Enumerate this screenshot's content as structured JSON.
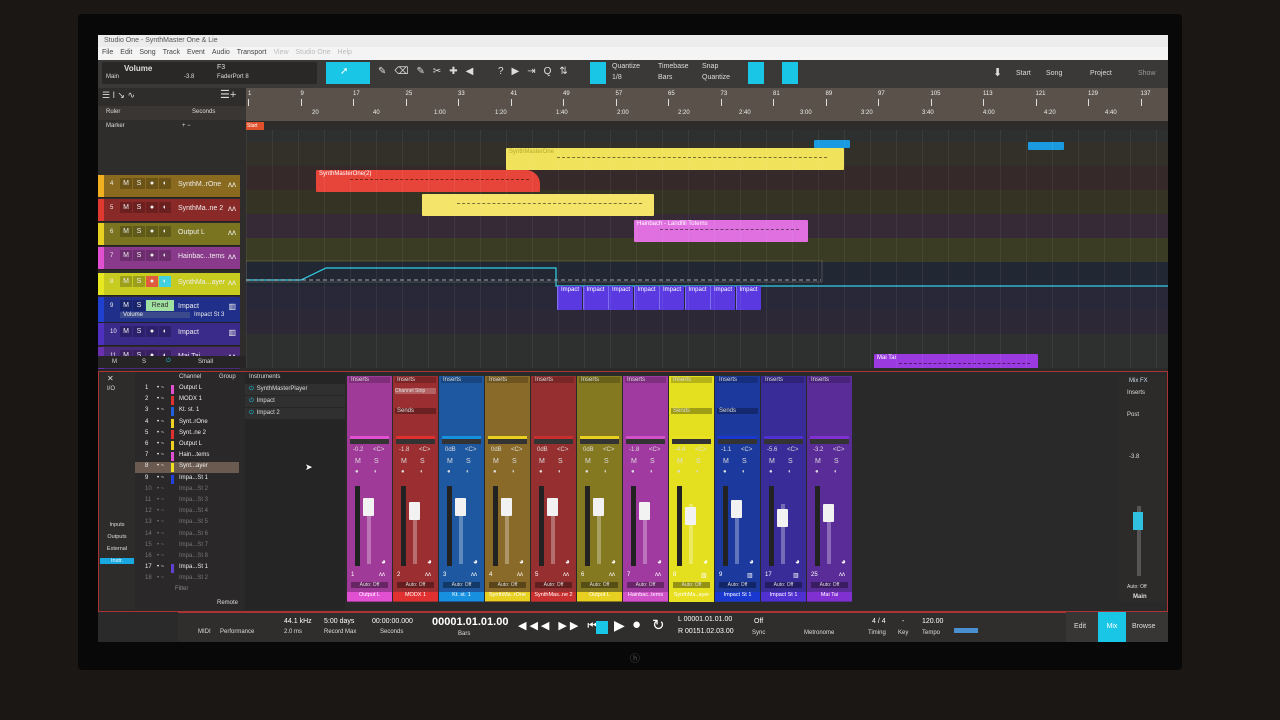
{
  "window": {
    "title": "Studio One - SynthMaster One & Lie"
  },
  "menu": [
    "File",
    "Edit",
    "Song",
    "Track",
    "Event",
    "Audio",
    "Transport",
    "View",
    "Studio One",
    "Help"
  ],
  "toolbar": {
    "param_name": "Volume",
    "param_scope": "Main",
    "param_value": "-3.8",
    "device_key": "F3",
    "device_name": "FaderPort 8",
    "quantize_label": "Quantize",
    "quantize_value": "1/8",
    "timebase_label": "Timebase",
    "timebase_value": "Bars",
    "snap_label": "Snap",
    "snap_value": "Quantize",
    "start": "Start",
    "song": "Song",
    "project": "Project",
    "show": "Show"
  },
  "ruler": {
    "label": "Ruler",
    "mode": "Seconds",
    "marker_label": "Marker",
    "start_marker": "Start",
    "bars": [
      "1",
      "9",
      "17",
      "25",
      "33",
      "41",
      "49",
      "57",
      "65",
      "73",
      "81",
      "89",
      "97",
      "105",
      "113",
      "121",
      "129",
      "137"
    ],
    "seconds": [
      "20",
      "40",
      "1:00",
      "1:20",
      "1:40",
      "2:00",
      "2:20",
      "2:40",
      "3:00",
      "3:20",
      "3:40",
      "4:00",
      "4:20",
      "4:40"
    ]
  },
  "tracks": [
    {
      "num": "4",
      "name": "SynthM..rOne",
      "color": "#8a6a1e",
      "stripe": "#f0b020"
    },
    {
      "num": "5",
      "name": "SynthMa..ne 2",
      "color": "#8a2a28",
      "stripe": "#e03a30"
    },
    {
      "num": "6",
      "name": "Output L",
      "color": "#7a7420",
      "stripe": "#e8d020"
    },
    {
      "num": "7",
      "name": "Hainbac...tems",
      "color": "#8a3a8a",
      "stripe": "#e050d0"
    },
    {
      "num": "8",
      "name": "SynthMa...ayer",
      "color": "#c8cc20",
      "stripe": "#e8e820"
    },
    {
      "num": "9",
      "name": "Impact",
      "color": "#20308a",
      "stripe": "#2040d0",
      "mode": "Read",
      "auto_param": "Volume",
      "auto_target": "Impact St 3"
    },
    {
      "num": "10",
      "name": "Impact",
      "color": "#3a2a8a",
      "stripe": "#5030c0"
    },
    {
      "num": "11",
      "name": "Mai Tai",
      "color": "#4a2a7a",
      "stripe": "#6a30b0"
    }
  ],
  "track_footer": {
    "m": "M",
    "s": "S",
    "size": "Small"
  },
  "clips": {
    "synth2": "SynthMasterOne(2)",
    "synth1": "SynthMasterOne",
    "hain": "Hainbach - Landfill Totems",
    "impact": "Impact",
    "maitai": "Mai Tai"
  },
  "mixer": {
    "io": "I/O",
    "side": [
      "Inputs",
      "Outputs",
      "External",
      "Instr."
    ],
    "list_headers": {
      "channel": "Channel",
      "group": "Group"
    },
    "channel_list": [
      {
        "n": "1",
        "name": "Output L",
        "c": "#e050d0"
      },
      {
        "n": "2",
        "name": "MODX 1",
        "c": "#e03030"
      },
      {
        "n": "3",
        "name": "Kt. st. 1",
        "c": "#2060e0"
      },
      {
        "n": "4",
        "name": "Synt..rOne",
        "c": "#f0d020"
      },
      {
        "n": "5",
        "name": "Synt..ne 2",
        "c": "#e03030"
      },
      {
        "n": "6",
        "name": "Output L",
        "c": "#f0d020"
      },
      {
        "n": "7",
        "name": "Hain...tems",
        "c": "#e050d0"
      },
      {
        "n": "8",
        "name": "Synt...ayer",
        "c": "#f0e020"
      },
      {
        "n": "9",
        "name": "Impa...St 1",
        "c": "#2040e0"
      },
      {
        "n": "10",
        "name": "Impa...St 2",
        "c": ""
      },
      {
        "n": "11",
        "name": "Impa...St 3",
        "c": ""
      },
      {
        "n": "12",
        "name": "Impa...St 4",
        "c": ""
      },
      {
        "n": "13",
        "name": "Impa...St 5",
        "c": ""
      },
      {
        "n": "14",
        "name": "Impa...St 6",
        "c": ""
      },
      {
        "n": "15",
        "name": "Impa...St 7",
        "c": ""
      },
      {
        "n": "16",
        "name": "Impa...St 8",
        "c": ""
      },
      {
        "n": "17",
        "name": "Impa...St 1",
        "c": "#6040d0"
      },
      {
        "n": "18",
        "name": "Impa...St 2",
        "c": ""
      }
    ],
    "filter": "Filter",
    "remote": "Remote",
    "instruments_header": "Instruments",
    "instruments": [
      "SynthMasterPlayer",
      "Impact",
      "Impact 2"
    ],
    "inserts": "Inserts",
    "sends": "Sends",
    "channel_strip": "Channel Strip",
    "auto": "Auto: Off",
    "pan": "<C>",
    "channels": [
      {
        "n": "1",
        "name": "Output L",
        "vol": "-0.2",
        "color": "#a03a98",
        "label_color": "#e050d0",
        "sends": false,
        "icon": "wave"
      },
      {
        "n": "2",
        "name": "MODX 1",
        "vol": "-1.8",
        "color": "#9a2e30",
        "label_color": "#e03030",
        "sends": true,
        "strip": true,
        "icon": "wave"
      },
      {
        "n": "3",
        "name": "Kt. st. 1",
        "vol": "0dB",
        "color": "#1e58a0",
        "label_color": "#1890e0",
        "sends": false,
        "icon": "wave"
      },
      {
        "n": "4",
        "name": "SynthMa..rOne",
        "vol": "0dB",
        "color": "#8a6a28",
        "label_color": "#e8d020",
        "sends": false,
        "icon": "wave"
      },
      {
        "n": "5",
        "name": "SynthMas..ne 2",
        "vol": "0dB",
        "color": "#963030",
        "label_color": "#c83030",
        "sends": false,
        "icon": "wave"
      },
      {
        "n": "6",
        "name": "Output L",
        "vol": "0dB",
        "color": "#847820",
        "label_color": "#e8d020",
        "sends": false,
        "icon": "wave"
      },
      {
        "n": "7",
        "name": "Hainbac..tems",
        "vol": "-1.8",
        "color": "#a03aa0",
        "label_color": "#d050c8",
        "sends": false,
        "icon": "wave"
      },
      {
        "n": "8",
        "name": "SynthMa..ayer",
        "vol": "-4.4",
        "color": "#e4e020",
        "label_color": "#e8e020",
        "sends": true,
        "icon": "keys"
      },
      {
        "n": "9",
        "name": "Impact St 1",
        "vol": "-1.1",
        "color": "#1c3a9e",
        "label_color": "#1838d0",
        "sends": true,
        "icon": "keys"
      },
      {
        "n": "17",
        "name": "Impact St 1",
        "vol": "-5.6",
        "color": "#3a2c98",
        "label_color": "#5030d0",
        "sends": false,
        "icon": "keys"
      },
      {
        "n": "25",
        "name": "Mai Tai",
        "vol": "-3.2",
        "color": "#5a2c98",
        "label_color": "#8030d0",
        "sends": false,
        "icon": "wave"
      }
    ],
    "main": {
      "mixfx": "Mix FX",
      "inserts": "Inserts",
      "post": "Post",
      "vol": "-3.8",
      "auto": "Auto: Off",
      "name": "Main"
    }
  },
  "transport": {
    "midi": "MIDI",
    "performance": "Performance",
    "rate": "44.1 kHz",
    "latency": "2.0 ms",
    "record_max": "5:00 days",
    "record_max_label": "Record Max",
    "seconds": "00:00:00.000",
    "seconds_label": "Seconds",
    "bars": "00001.01.01.00",
    "bars_label": "Bars",
    "loop_l": "L  00001.01.01.00",
    "loop_r": "R  00151.02.03.00",
    "sync": "Off",
    "sync_label": "Sync",
    "metronome": "Metronome",
    "timing": "4 / 4",
    "timing_label": "Timing",
    "key": "-",
    "key_label": "Key",
    "tempo": "120.00",
    "tempo_label": "Tempo"
  },
  "views": {
    "edit": "Edit",
    "mix": "Mix",
    "browse": "Browse"
  },
  "colors": {
    "accent": "#19c6e6",
    "record_border": "#a33333"
  }
}
